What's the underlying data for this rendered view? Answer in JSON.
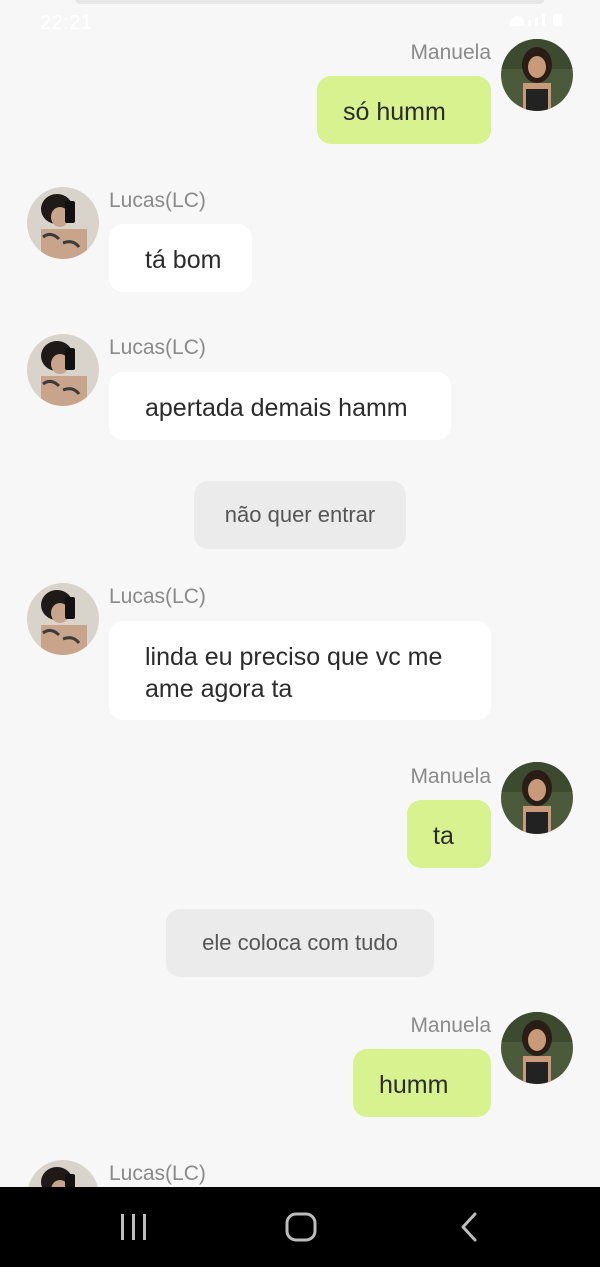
{
  "status_bar": {
    "time": "22:21"
  },
  "messages": [
    {
      "kind": "outgoing",
      "sender": "Manuela",
      "text": "só humm"
    },
    {
      "kind": "incoming",
      "sender": "Lucas(LC)",
      "text": "tá bom"
    },
    {
      "kind": "incoming",
      "sender": "Lucas(LC)",
      "text": "apertada demais hamm"
    },
    {
      "kind": "system",
      "text": "não quer entrar"
    },
    {
      "kind": "incoming",
      "sender": "Lucas(LC)",
      "text": "linda eu preciso que vc me ame agora ta"
    },
    {
      "kind": "outgoing",
      "sender": "Manuela",
      "text": "ta"
    },
    {
      "kind": "system",
      "text": "ele coloca com tudo"
    },
    {
      "kind": "outgoing",
      "sender": "Manuela",
      "text": "humm"
    },
    {
      "kind": "incoming",
      "sender": "Lucas(LC)",
      "text": ""
    }
  ],
  "colors": {
    "background": "#f7f7f7",
    "outgoing_bubble": "#d7f28e",
    "incoming_bubble": "#ffffff",
    "system_pill": "#ebebeb",
    "name_text": "#8a8a8a",
    "nav_bar": "#000000"
  },
  "nav_bar": {
    "icons": [
      "recent-apps-icon",
      "home-icon",
      "back-icon"
    ]
  }
}
